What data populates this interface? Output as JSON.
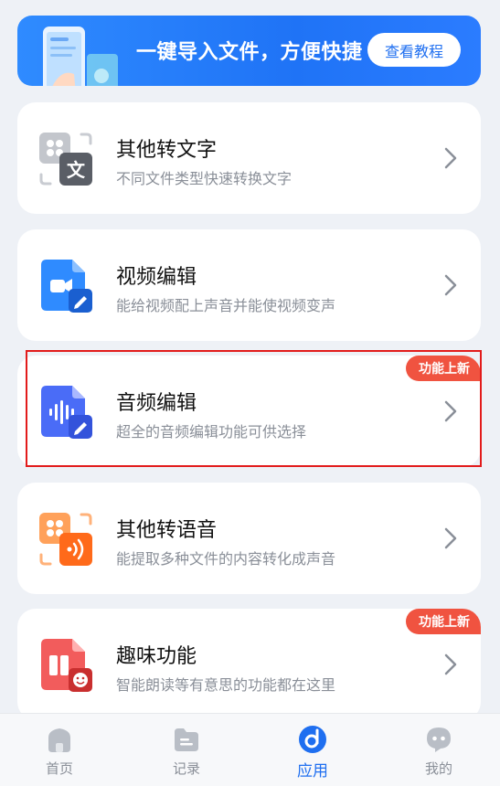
{
  "banner": {
    "title": "一键导入文件，方便快捷",
    "button": "查看教程",
    "pages": 2,
    "active_page": 2
  },
  "cards": [
    {
      "title": "其他转文字",
      "desc": "不同文件类型快速转换文字",
      "icon": "text-convert-icon"
    },
    {
      "title": "视频编辑",
      "desc": "能给视频配上声音并能使视频变声",
      "icon": "video-edit-icon"
    },
    {
      "title": "音频编辑",
      "desc": "超全的音频编辑功能可供选择",
      "icon": "audio-edit-icon",
      "badge": "功能上新"
    },
    {
      "title": "其他转语音",
      "desc": "能提取多种文件的内容转化成声音",
      "icon": "speech-convert-icon"
    },
    {
      "title": "趣味功能",
      "desc": "智能朗读等有意思的功能都在这里",
      "icon": "fun-feature-icon",
      "badge": "功能上新"
    }
  ],
  "nav": {
    "items": [
      {
        "label": "首页",
        "icon": "home-icon"
      },
      {
        "label": "记录",
        "icon": "folder-icon"
      },
      {
        "label": "应用",
        "icon": "app-icon",
        "active": true
      },
      {
        "label": "我的",
        "icon": "profile-icon"
      }
    ]
  },
  "colors": {
    "accent": "#1f6ff0",
    "badge": "#f05340",
    "highlight_border": "#e21b1b"
  }
}
